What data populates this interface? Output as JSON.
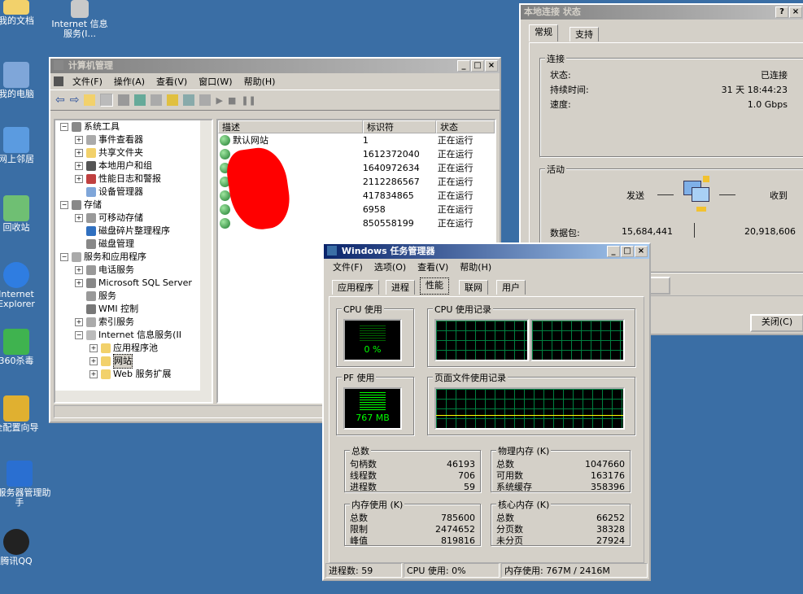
{
  "desktop": {
    "icons": [
      {
        "label": "我的文档",
        "color": "#f2d16b"
      },
      {
        "label": "Internet 信息服务(I...",
        "color": "#c9c9c9"
      },
      {
        "label": "我的电脑",
        "color": "#7fa6d9"
      },
      {
        "label": "网上邻居",
        "color": "#5b9be0"
      },
      {
        "label": "回收站",
        "color": "#6fbf73"
      },
      {
        "label": "Internet Explorer",
        "color": "#2f7de1"
      },
      {
        "label": "360杀毒",
        "color": "#3fb34f"
      },
      {
        "label": "全配置向导",
        "color": "#e0b030"
      },
      {
        "label": "安服务器管理助手",
        "color": "#2a6fd1"
      },
      {
        "label": "腾讯QQ",
        "color": "#222222"
      }
    ]
  },
  "net_status": {
    "title": "本地连接 状态",
    "help": "?",
    "close": "×",
    "tabs": [
      "常规",
      "支持"
    ],
    "connection": {
      "legend": "连接",
      "rows": [
        {
          "label": "状态:",
          "value": "已连接"
        },
        {
          "label": "持续时间:",
          "value": "31 天 18:44:23"
        },
        {
          "label": "速度:",
          "value": "1.0 Gbps"
        }
      ]
    },
    "activity": {
      "legend": "活动",
      "send": "发送",
      "recv": "收到",
      "packets_label": "数据包:",
      "sent": "15,684,441",
      "received": "20,918,606"
    },
    "close_button": "关闭(C)"
  },
  "comp_mgmt": {
    "title": "计算机管理",
    "menus": [
      "文件(F)",
      "操作(A)",
      "查看(V)",
      "窗口(W)",
      "帮助(H)"
    ],
    "tree": [
      {
        "label": "系统工具",
        "level": 0,
        "pm": "−",
        "color": "#888"
      },
      {
        "label": "事件查看器",
        "level": 1,
        "pm": "+",
        "color": "#aaa"
      },
      {
        "label": "共享文件夹",
        "level": 1,
        "pm": "+",
        "color": "#f2d16b"
      },
      {
        "label": "本地用户和组",
        "level": 1,
        "pm": "+",
        "color": "#555"
      },
      {
        "label": "性能日志和警报",
        "level": 1,
        "pm": "+",
        "color": "#c04040"
      },
      {
        "label": "设备管理器",
        "level": 1,
        "pm": "",
        "color": "#7fa6d9"
      },
      {
        "label": "存储",
        "level": 0,
        "pm": "−",
        "color": "#888"
      },
      {
        "label": "可移动存储",
        "level": 1,
        "pm": "+",
        "color": "#999"
      },
      {
        "label": "磁盘碎片整理程序",
        "level": 1,
        "pm": "",
        "color": "#3070c0"
      },
      {
        "label": "磁盘管理",
        "level": 1,
        "pm": "",
        "color": "#888"
      },
      {
        "label": "服务和应用程序",
        "level": 0,
        "pm": "−",
        "color": "#aaa"
      },
      {
        "label": "电话服务",
        "level": 1,
        "pm": "+",
        "color": "#999"
      },
      {
        "label": "Microsoft SQL Server",
        "level": 1,
        "pm": "+",
        "color": "#888"
      },
      {
        "label": "服务",
        "level": 1,
        "pm": "",
        "color": "#999"
      },
      {
        "label": "WMI 控制",
        "level": 1,
        "pm": "",
        "color": "#777"
      },
      {
        "label": "索引服务",
        "level": 1,
        "pm": "+",
        "color": "#aaa"
      },
      {
        "label": "Internet 信息服务(II",
        "level": 1,
        "pm": "−",
        "color": "#bbb"
      },
      {
        "label": "应用程序池",
        "level": 2,
        "pm": "+",
        "color": "#f2d16b"
      },
      {
        "label": "网站",
        "level": 2,
        "pm": "+",
        "color": "#f2d16b"
      },
      {
        "label": "Web 服务扩展",
        "level": 2,
        "pm": "+",
        "color": "#f2d16b"
      }
    ],
    "columns": [
      "描述",
      "标识符",
      "状态"
    ],
    "rows": [
      {
        "desc": "默认网站",
        "id": "1",
        "status": "正在运行"
      },
      {
        "desc": "",
        "id": "1612372040",
        "status": "正在运行"
      },
      {
        "desc": "",
        "id": "1640972634",
        "status": "正在运行"
      },
      {
        "desc": "",
        "id": "2112286567",
        "status": "正在运行"
      },
      {
        "desc": "",
        "id": "417834865",
        "status": "正在运行"
      },
      {
        "desc": "",
        "id": "6958",
        "status": "正在运行"
      },
      {
        "desc": "",
        "id": "850558199",
        "status": "正在运行"
      }
    ]
  },
  "task_mgr": {
    "title": "Windows 任务管理器",
    "menus": [
      "文件(F)",
      "选项(O)",
      "查看(V)",
      "帮助(H)"
    ],
    "tabs": [
      "应用程序",
      "进程",
      "性能",
      "联网",
      "用户"
    ],
    "selected_tab": "性能",
    "cpu_usage": {
      "legend": "CPU 使用",
      "value": "0 %",
      "percent": 0
    },
    "cpu_history": {
      "legend": "CPU 使用记录"
    },
    "pf_usage": {
      "legend": "PF 使用",
      "value": "767 MB"
    },
    "pf_history": {
      "legend": "页面文件使用记录"
    },
    "totals": {
      "legend": "总数",
      "rows": [
        {
          "label": "句柄数",
          "value": "46193"
        },
        {
          "label": "线程数",
          "value": "706"
        },
        {
          "label": "进程数",
          "value": "59"
        }
      ]
    },
    "physical": {
      "legend": "物理内存 (K)",
      "rows": [
        {
          "label": "总数",
          "value": "1047660"
        },
        {
          "label": "可用数",
          "value": "163176"
        },
        {
          "label": "系统缓存",
          "value": "358396"
        }
      ]
    },
    "commit": {
      "legend": "内存使用 (K)",
      "rows": [
        {
          "label": "总数",
          "value": "785600"
        },
        {
          "label": "限制",
          "value": "2474652"
        },
        {
          "label": "峰值",
          "value": "819816"
        }
      ]
    },
    "kernel": {
      "legend": "核心内存 (K)",
      "rows": [
        {
          "label": "总数",
          "value": "66252"
        },
        {
          "label": "分页数",
          "value": "38328"
        },
        {
          "label": "未分页",
          "value": "27924"
        }
      ]
    },
    "status": {
      "processes": "进程数: 59",
      "cpu": "CPU 使用: 0%",
      "memory": "内存使用: 767M / 2416M"
    }
  }
}
